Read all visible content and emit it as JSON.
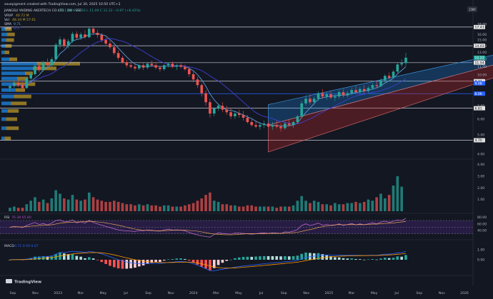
{
  "header": {
    "created_by": "savepigment created with TradingView.com, Jul 30, 2025 10:50 UTC+2",
    "symbol_line": "JIANGSU YAIDING AKERTECH CO LTD · 1W · SSE",
    "ohlc": "O 11.48 H 12.93 L 11.09 C 12.22 −0.97 (+8.42%)",
    "vrvp_label": "VRVP",
    "vrvp_values": "40.72 M",
    "vol_label": "Vol",
    "vol_values": "48.34 M  57.61",
    "sma1_label": "SMA",
    "sma1_value": "9.71",
    "sma2_label": "SMA",
    "sma2_value": "8.07",
    "currency_badge": "CNY"
  },
  "colors": {
    "background": "#131722",
    "up": "#26a69a",
    "down": "#ef5350",
    "sma_fast": "#5b9bd5",
    "sma_slow": "#3f3fd0",
    "channel_upper": "#2962ff",
    "channel_lower": "#b71c1c",
    "vp_up": "#1e88e5",
    "vp_down": "#c5a028",
    "rsi_bg": "#2d1f4d",
    "rsi_line": "#ab47bc",
    "macd_line": "#2962ff",
    "signal_line": "#ff9800"
  },
  "price_axis": {
    "ticks": [
      "18.00",
      "16.00",
      "15.00",
      "14.00",
      "13.00",
      "12.00",
      "11.00",
      "10.00",
      "9.00",
      "8.00",
      "7.00",
      "6.00",
      "5.00",
      "4.00",
      "3.00",
      "2.00"
    ],
    "tags": [
      {
        "text": "17.43",
        "color": "#e0e0e0",
        "fg": "#131722"
      },
      {
        "text": "14.03",
        "color": "#e0e0e0",
        "fg": "#131722"
      },
      {
        "text": "12.22",
        "color": "#26a69a",
        "fg": "#ffffff"
      },
      {
        "text": "11.54",
        "color": "#e0e0e0",
        "fg": "#131722"
      },
      {
        "text": "9.31",
        "color": "#e0e0e0",
        "fg": "#131722"
      },
      {
        "text": "9.08",
        "color": "#2962ff",
        "fg": "#ffffff"
      },
      {
        "text": "8.06",
        "color": "#2962ff",
        "fg": "#ffffff"
      },
      {
        "text": "6.81",
        "color": "#e0e0e0",
        "fg": "#131722"
      },
      {
        "text": "4.70",
        "color": "#e0e0e0",
        "fg": "#131722"
      }
    ]
  },
  "horizontal_levels": [
    17.43,
    14.03,
    11.54,
    9.31,
    8.06,
    6.81,
    4.7
  ],
  "vol_axis_ticks": [
    "4.00",
    "3.00",
    "2.00",
    "1.00"
  ],
  "rsi": {
    "label": "RSI",
    "values": "76.38  65.80",
    "axis_ticks": [
      "80.00",
      "60.00",
      "40.00"
    ]
  },
  "macd": {
    "label": "MACD",
    "values": "0.72  0.59  0.67",
    "axis_ticks": [
      "1.00",
      "0.00"
    ]
  },
  "time_axis": [
    "Sep",
    "Nov",
    "2023",
    "Mar",
    "May",
    "Jul",
    "Sep",
    "Nov",
    "2024",
    "Mar",
    "May",
    "Jul",
    "Sep",
    "Nov",
    "2025",
    "Mar",
    "May",
    "Jul",
    "Sep",
    "Nov",
    "2026"
  ],
  "logo_text": "TradingView",
  "chart_data": {
    "type": "candlestick",
    "title": "JIANGSU YAIDING AKERTECH CO LTD · 1W · SSE",
    "ylim": [
      3.0,
      19.0
    ],
    "candles": [
      [
        8.6,
        9.0,
        8.2,
        8.8
      ],
      [
        8.8,
        9.4,
        8.6,
        9.1
      ],
      [
        9.1,
        9.5,
        8.7,
        8.9
      ],
      [
        8.9,
        9.2,
        8.4,
        8.6
      ],
      [
        8.6,
        9.8,
        8.5,
        9.6
      ],
      [
        9.6,
        10.4,
        9.3,
        10.1
      ],
      [
        10.1,
        11.4,
        9.9,
        11.1
      ],
      [
        11.1,
        11.5,
        10.3,
        10.6
      ],
      [
        10.6,
        11.8,
        10.4,
        11.6
      ],
      [
        11.6,
        12.1,
        10.9,
        11.2
      ],
      [
        11.2,
        12.3,
        11.0,
        12.0
      ],
      [
        12.0,
        14.5,
        11.9,
        14.2
      ],
      [
        14.2,
        15.6,
        13.6,
        15.1
      ],
      [
        15.1,
        15.4,
        13.7,
        14.0
      ],
      [
        14.0,
        15.2,
        13.6,
        14.8
      ],
      [
        14.8,
        16.5,
        14.5,
        16.1
      ],
      [
        16.1,
        16.6,
        15.1,
        15.4
      ],
      [
        15.4,
        16.4,
        15.0,
        16.0
      ],
      [
        16.0,
        16.8,
        15.2,
        15.5
      ],
      [
        15.5,
        17.4,
        15.3,
        17.1
      ],
      [
        17.1,
        17.6,
        15.9,
        16.3
      ],
      [
        16.3,
        16.9,
        15.4,
        15.9
      ],
      [
        15.9,
        16.3,
        14.6,
        15.0
      ],
      [
        15.0,
        15.5,
        14.1,
        14.4
      ],
      [
        14.4,
        14.9,
        13.5,
        13.8
      ],
      [
        13.8,
        14.2,
        12.6,
        12.9
      ],
      [
        12.9,
        13.3,
        11.9,
        12.2
      ],
      [
        12.2,
        12.5,
        11.4,
        11.6
      ],
      [
        11.6,
        11.9,
        10.9,
        11.2
      ],
      [
        11.2,
        11.6,
        10.8,
        11.0
      ],
      [
        11.0,
        11.3,
        10.5,
        10.8
      ],
      [
        10.8,
        11.4,
        10.6,
        11.2
      ],
      [
        11.2,
        11.5,
        10.6,
        10.9
      ],
      [
        10.9,
        11.6,
        10.7,
        11.4
      ],
      [
        11.4,
        11.8,
        11.0,
        11.2
      ],
      [
        11.2,
        11.5,
        10.7,
        10.9
      ],
      [
        10.9,
        11.2,
        10.4,
        10.7
      ],
      [
        10.7,
        11.4,
        10.5,
        11.2
      ],
      [
        11.2,
        11.6,
        10.9,
        11.4
      ],
      [
        11.4,
        11.7,
        10.8,
        11.0
      ],
      [
        11.0,
        11.4,
        10.6,
        11.2
      ],
      [
        11.2,
        11.5,
        10.8,
        11.0
      ],
      [
        11.0,
        11.3,
        10.5,
        10.7
      ],
      [
        10.7,
        11.0,
        9.8,
        10.1
      ],
      [
        10.1,
        10.4,
        9.2,
        9.5
      ],
      [
        9.5,
        9.8,
        8.6,
        8.9
      ],
      [
        8.9,
        9.1,
        7.8,
        8.1
      ],
      [
        8.1,
        8.4,
        7.0,
        7.3
      ],
      [
        7.3,
        7.6,
        6.1,
        6.4
      ],
      [
        6.4,
        6.9,
        6.2,
        6.8
      ],
      [
        6.8,
        7.2,
        6.6,
        7.0
      ],
      [
        7.0,
        7.3,
        6.5,
        6.7
      ],
      [
        6.7,
        7.0,
        6.3,
        6.5
      ],
      [
        6.5,
        6.8,
        6.0,
        6.2
      ],
      [
        6.2,
        6.6,
        6.0,
        6.4
      ],
      [
        6.4,
        6.7,
        6.1,
        6.3
      ],
      [
        6.3,
        6.6,
        5.9,
        6.1
      ],
      [
        6.1,
        6.3,
        5.7,
        5.8
      ],
      [
        5.8,
        6.0,
        5.5,
        5.6
      ],
      [
        5.6,
        5.9,
        5.4,
        5.5
      ],
      [
        5.5,
        5.8,
        5.3,
        5.6
      ],
      [
        5.6,
        5.9,
        5.4,
        5.7
      ],
      [
        5.7,
        5.9,
        5.4,
        5.5
      ],
      [
        5.5,
        5.8,
        5.3,
        5.6
      ],
      [
        5.6,
        5.9,
        5.4,
        5.5
      ],
      [
        5.5,
        5.7,
        5.2,
        5.4
      ],
      [
        5.4,
        5.8,
        5.3,
        5.7
      ],
      [
        5.7,
        6.0,
        5.5,
        5.6
      ],
      [
        5.6,
        5.9,
        5.4,
        5.8
      ],
      [
        5.8,
        6.3,
        5.7,
        6.2
      ],
      [
        6.2,
        7.4,
        6.1,
        7.2
      ],
      [
        7.2,
        7.9,
        7.0,
        7.6
      ],
      [
        7.6,
        8.0,
        7.1,
        7.3
      ],
      [
        7.3,
        7.8,
        7.1,
        7.6
      ],
      [
        7.6,
        8.3,
        7.4,
        8.1
      ],
      [
        8.1,
        8.5,
        7.6,
        7.8
      ],
      [
        7.8,
        8.2,
        7.5,
        8.0
      ],
      [
        8.0,
        8.3,
        7.6,
        7.7
      ],
      [
        7.7,
        8.0,
        7.4,
        7.8
      ],
      [
        7.8,
        8.4,
        7.6,
        8.2
      ],
      [
        8.2,
        8.5,
        7.7,
        7.9
      ],
      [
        7.9,
        8.3,
        7.7,
        8.1
      ],
      [
        8.1,
        8.6,
        7.9,
        8.4
      ],
      [
        8.4,
        8.8,
        8.0,
        8.2
      ],
      [
        8.2,
        8.7,
        8.0,
        8.5
      ],
      [
        8.5,
        8.9,
        8.1,
        8.3
      ],
      [
        8.3,
        8.8,
        8.1,
        8.6
      ],
      [
        8.6,
        9.1,
        8.4,
        8.9
      ],
      [
        8.9,
        9.4,
        8.6,
        8.8
      ],
      [
        8.8,
        9.6,
        8.7,
        9.4
      ],
      [
        9.4,
        10.1,
        9.2,
        9.9
      ],
      [
        9.9,
        10.3,
        9.5,
        9.7
      ],
      [
        9.7,
        10.6,
        9.6,
        10.4
      ],
      [
        10.4,
        11.6,
        10.2,
        11.3
      ],
      [
        11.3,
        12.0,
        11.0,
        11.48
      ],
      [
        11.48,
        12.93,
        11.09,
        12.22
      ]
    ],
    "volume_millions": [
      0.3,
      0.4,
      0.3,
      0.3,
      0.6,
      0.9,
      1.2,
      0.8,
      1.0,
      0.7,
      1.1,
      1.8,
      1.5,
      1.1,
      1.0,
      1.4,
      1.0,
      0.9,
      1.0,
      1.6,
      1.2,
      1.0,
      0.9,
      0.8,
      0.8,
      0.9,
      0.8,
      0.7,
      0.6,
      0.6,
      0.5,
      0.6,
      0.5,
      0.6,
      0.5,
      0.5,
      0.4,
      0.5,
      0.5,
      0.4,
      0.4,
      0.4,
      0.5,
      0.6,
      0.7,
      0.9,
      1.1,
      1.4,
      1.6,
      0.9,
      0.8,
      0.6,
      0.6,
      0.5,
      0.5,
      0.4,
      0.4,
      0.5,
      0.5,
      0.4,
      0.4,
      0.4,
      0.4,
      0.4,
      0.3,
      0.4,
      0.4,
      0.4,
      0.5,
      0.9,
      1.3,
      0.9,
      0.7,
      0.9,
      0.8,
      0.6,
      0.6,
      0.5,
      0.7,
      0.6,
      0.6,
      0.7,
      0.7,
      0.8,
      0.7,
      0.8,
      1.0,
      0.9,
      1.2,
      1.5,
      1.1,
      1.4,
      2.2,
      3.0,
      2.1
    ],
    "rsi": [
      50,
      52,
      51,
      49,
      55,
      60,
      64,
      58,
      61,
      57,
      62,
      70,
      72,
      66,
      67,
      72,
      63,
      66,
      62,
      71,
      64,
      60,
      56,
      52,
      49,
      45,
      42,
      40,
      39,
      38,
      37,
      40,
      39,
      42,
      41,
      39,
      38,
      42,
      44,
      41,
      42,
      41,
      39,
      34,
      30,
      27,
      24,
      22,
      20,
      28,
      33,
      31,
      30,
      29,
      32,
      32,
      31,
      30,
      29,
      30,
      32,
      33,
      31,
      33,
      32,
      31,
      36,
      35,
      38,
      43,
      55,
      60,
      55,
      58,
      62,
      56,
      58,
      55,
      56,
      60,
      55,
      58,
      61,
      57,
      60,
      57,
      60,
      63,
      60,
      65,
      68,
      64,
      68,
      72,
      70,
      76.38
    ],
    "macd": [
      0.0,
      0.02,
      0.03,
      0.02,
      0.06,
      0.12,
      0.22,
      0.26,
      0.32,
      0.33,
      0.38,
      0.55,
      0.72,
      0.74,
      0.77,
      0.85,
      0.8,
      0.8,
      0.74,
      0.82,
      0.78,
      0.7,
      0.59,
      0.45,
      0.3,
      0.15,
      0.0,
      -0.12,
      -0.22,
      -0.3,
      -0.36,
      -0.38,
      -0.4,
      -0.38,
      -0.36,
      -0.36,
      -0.37,
      -0.32,
      -0.26,
      -0.24,
      -0.2,
      -0.18,
      -0.2,
      -0.28,
      -0.4,
      -0.55,
      -0.72,
      -0.9,
      -1.1,
      -1.1,
      -1.02,
      -0.95,
      -0.88,
      -0.82,
      -0.74,
      -0.68,
      -0.62,
      -0.58,
      -0.55,
      -0.5,
      -0.45,
      -0.4,
      -0.36,
      -0.32,
      -0.28,
      -0.25,
      -0.2,
      -0.17,
      -0.12,
      -0.05,
      0.1,
      0.24,
      0.3,
      0.36,
      0.44,
      0.46,
      0.48,
      0.46,
      0.44,
      0.46,
      0.44,
      0.44,
      0.46,
      0.44,
      0.44,
      0.42,
      0.44,
      0.46,
      0.44,
      0.5,
      0.56,
      0.56,
      0.6,
      0.7,
      0.72,
      0.85
    ],
    "volume_profile": [
      {
        "price": 17.0,
        "up": 0.05,
        "down": 0.08
      },
      {
        "price": 16.0,
        "up": 0.07,
        "down": 0.1
      },
      {
        "price": 15.0,
        "up": 0.06,
        "down": 0.1
      },
      {
        "price": 14.0,
        "up": 0.05,
        "down": 0.08
      },
      {
        "price": 13.0,
        "up": 0.04,
        "down": 0.06
      },
      {
        "price": 12.0,
        "up": 0.1,
        "down": 0.1
      },
      {
        "price": 11.4,
        "up": 0.45,
        "down": 0.55
      },
      {
        "price": 10.8,
        "up": 0.4,
        "down": 0.3
      },
      {
        "price": 10.2,
        "up": 0.3,
        "down": 0.1
      },
      {
        "price": 9.6,
        "up": 0.2,
        "down": 0.14
      },
      {
        "price": 9.0,
        "up": 0.15,
        "down": 0.28
      },
      {
        "price": 8.4,
        "up": 0.18,
        "down": 0.12
      },
      {
        "price": 7.8,
        "up": 0.16,
        "down": 0.22
      },
      {
        "price": 7.2,
        "up": 0.12,
        "down": 0.2
      },
      {
        "price": 6.6,
        "up": 0.08,
        "down": 0.14
      },
      {
        "price": 6.0,
        "up": 0.06,
        "down": 0.14
      },
      {
        "price": 5.4,
        "up": 0.06,
        "down": 0.16
      },
      {
        "price": 4.8,
        "up": 0.04,
        "down": 0.08
      }
    ],
    "channel": {
      "start_index": 62,
      "end_index": 104,
      "upper": [
        [
          7.1,
          13.2
        ]
      ],
      "mid": [
        [
          5.6,
          11.9
        ]
      ],
      "lower": [
        [
          4.1,
          10.4
        ]
      ]
    }
  }
}
